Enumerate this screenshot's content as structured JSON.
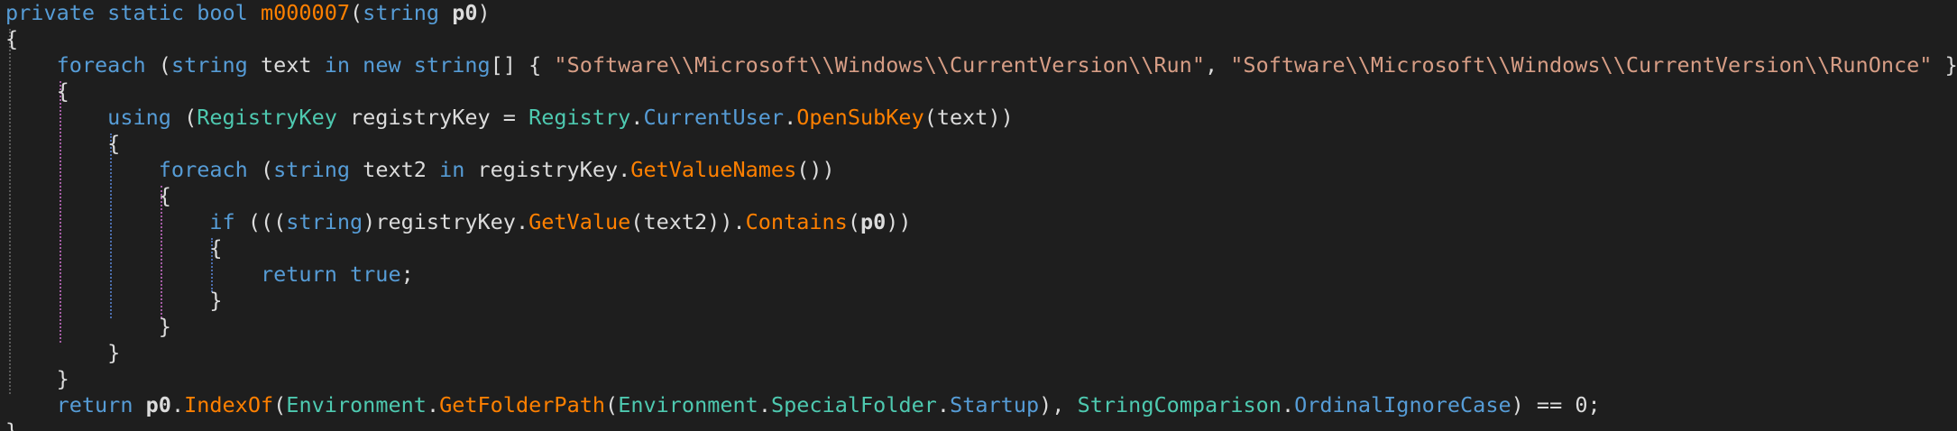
{
  "editor": {
    "colors": {
      "background": "#1e1e1e",
      "keyword": "#569cd6",
      "type": "#4ec9b0",
      "method": "#ff8000",
      "string": "#d69d85",
      "identifier": "#dcdcdc"
    },
    "lines": [
      [
        {
          "t": "private static bool ",
          "c": "kw"
        },
        {
          "t": "m000007",
          "c": "mth"
        },
        {
          "t": "(",
          "c": "pun"
        },
        {
          "t": "string ",
          "c": "kw"
        },
        {
          "t": "p0",
          "c": "prm"
        },
        {
          "t": ")",
          "c": "pun"
        }
      ],
      [
        {
          "t": "{",
          "c": "pun"
        }
      ],
      [
        {
          "t": "    foreach ",
          "c": "kw"
        },
        {
          "t": "(",
          "c": "pun"
        },
        {
          "t": "string ",
          "c": "kw"
        },
        {
          "t": "text ",
          "c": "id"
        },
        {
          "t": "in new string",
          "c": "kw"
        },
        {
          "t": "[] { ",
          "c": "pun"
        },
        {
          "t": "\"Software\\\\Microsoft\\\\Windows\\\\CurrentVersion\\\\Run\"",
          "c": "str"
        },
        {
          "t": ", ",
          "c": "pun"
        },
        {
          "t": "\"Software\\\\Microsoft\\\\Windows\\\\CurrentVersion\\\\RunOnce\"",
          "c": "str"
        },
        {
          "t": " })",
          "c": "pun"
        }
      ],
      [
        {
          "t": "    {",
          "c": "pun"
        }
      ],
      [
        {
          "t": "        using ",
          "c": "kw"
        },
        {
          "t": "(",
          "c": "pun"
        },
        {
          "t": "RegistryKey ",
          "c": "typ"
        },
        {
          "t": "registryKey = ",
          "c": "id"
        },
        {
          "t": "Registry",
          "c": "typ"
        },
        {
          "t": ".",
          "c": "pun"
        },
        {
          "t": "CurrentUser",
          "c": "kw"
        },
        {
          "t": ".",
          "c": "pun"
        },
        {
          "t": "OpenSubKey",
          "c": "mth"
        },
        {
          "t": "(text))",
          "c": "id"
        }
      ],
      [
        {
          "t": "        {",
          "c": "pun"
        }
      ],
      [
        {
          "t": "            foreach ",
          "c": "kw"
        },
        {
          "t": "(",
          "c": "pun"
        },
        {
          "t": "string ",
          "c": "kw"
        },
        {
          "t": "text2 ",
          "c": "id"
        },
        {
          "t": "in ",
          "c": "kw"
        },
        {
          "t": "registryKey.",
          "c": "id"
        },
        {
          "t": "GetValueNames",
          "c": "mth"
        },
        {
          "t": "())",
          "c": "pun"
        }
      ],
      [
        {
          "t": "            {",
          "c": "pun"
        }
      ],
      [
        {
          "t": "                if ",
          "c": "kw"
        },
        {
          "t": "(((",
          "c": "pun"
        },
        {
          "t": "string",
          "c": "kw"
        },
        {
          "t": ")registryKey.",
          "c": "id"
        },
        {
          "t": "GetValue",
          "c": "mth"
        },
        {
          "t": "(text2)).",
          "c": "id"
        },
        {
          "t": "Contains",
          "c": "mth"
        },
        {
          "t": "(",
          "c": "pun"
        },
        {
          "t": "p0",
          "c": "prm"
        },
        {
          "t": "))",
          "c": "pun"
        }
      ],
      [
        {
          "t": "                {",
          "c": "pun"
        }
      ],
      [
        {
          "t": "                    return true",
          "c": "kw"
        },
        {
          "t": ";",
          "c": "pun"
        }
      ],
      [
        {
          "t": "                }",
          "c": "pun"
        }
      ],
      [
        {
          "t": "            }",
          "c": "pun"
        }
      ],
      [
        {
          "t": "        }",
          "c": "pun"
        }
      ],
      [
        {
          "t": "    }",
          "c": "pun"
        }
      ],
      [
        {
          "t": "    return ",
          "c": "kw"
        },
        {
          "t": "p0",
          "c": "prm"
        },
        {
          "t": ".",
          "c": "pun"
        },
        {
          "t": "IndexOf",
          "c": "mth"
        },
        {
          "t": "(",
          "c": "pun"
        },
        {
          "t": "Environment",
          "c": "typ"
        },
        {
          "t": ".",
          "c": "pun"
        },
        {
          "t": "GetFolderPath",
          "c": "mth"
        },
        {
          "t": "(",
          "c": "pun"
        },
        {
          "t": "Environment",
          "c": "typ"
        },
        {
          "t": ".",
          "c": "pun"
        },
        {
          "t": "SpecialFolder",
          "c": "typ"
        },
        {
          "t": ".",
          "c": "pun"
        },
        {
          "t": "Startup",
          "c": "kw"
        },
        {
          "t": "), ",
          "c": "pun"
        },
        {
          "t": "StringComparison",
          "c": "typ"
        },
        {
          "t": ".",
          "c": "pun"
        },
        {
          "t": "OrdinalIgnoreCase",
          "c": "kw"
        },
        {
          "t": ") == 0;",
          "c": "pun"
        }
      ],
      [
        {
          "t": "}",
          "c": "pun"
        }
      ]
    ]
  }
}
